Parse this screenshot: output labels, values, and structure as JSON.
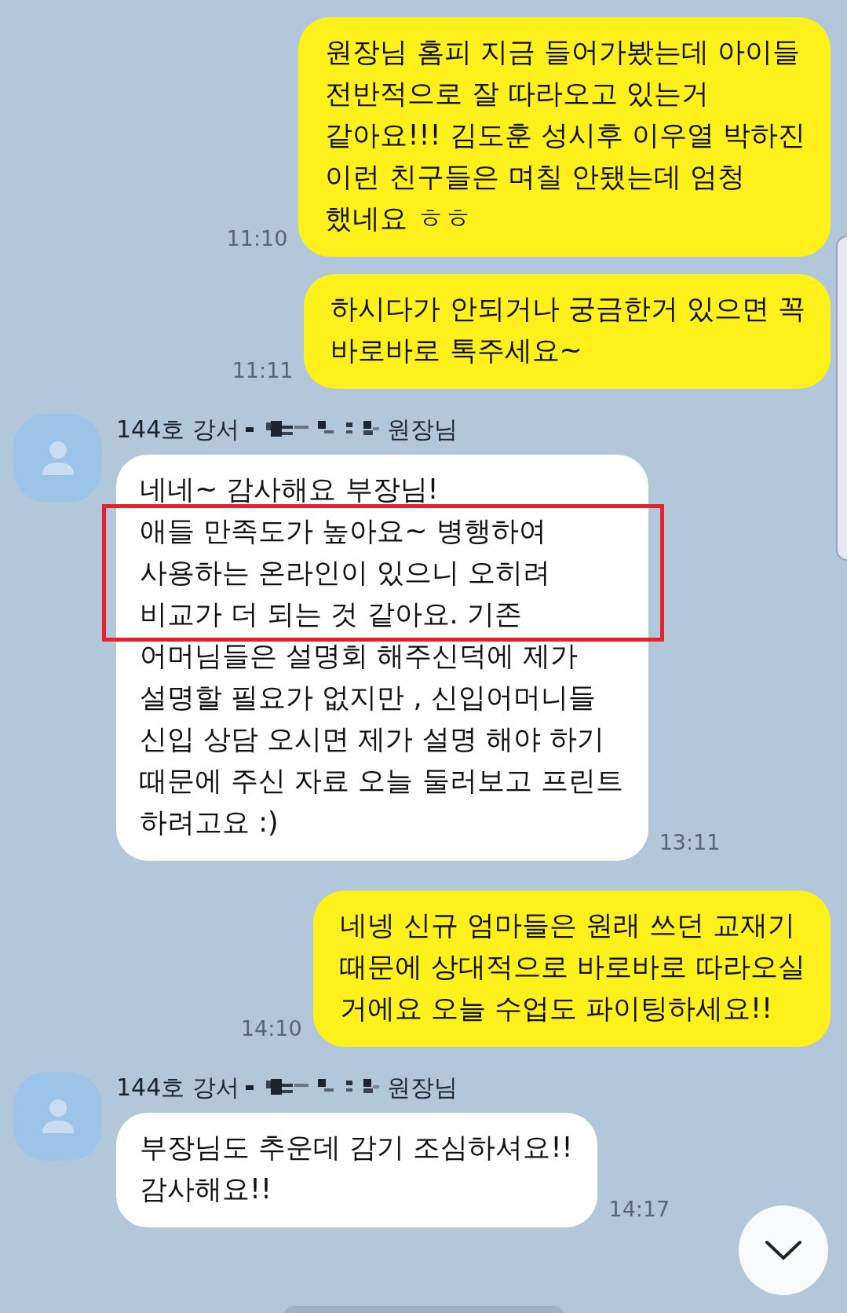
{
  "messages": [
    {
      "kind": "sent",
      "time": "11:10",
      "lines": [
        {
          "text": "원장님 홈피 지금 들어가봤는데 아이들",
          "highlighted": false
        },
        {
          "text": "전반적으로 잘 따라오고 있는거",
          "highlighted": false
        },
        {
          "text": "같아요!!! 김도훈 성시후 이우열 박하진",
          "highlighted": false
        },
        {
          "text": "이런 친구들은 며칠 안됐는데 엄청",
          "highlighted": false
        },
        {
          "text": "했네요 ㅎㅎ",
          "highlighted": false
        }
      ]
    },
    {
      "kind": "sent",
      "time": "11:11",
      "lines": [
        {
          "text": "하시다가 안되거나 궁금한거 있으면 꼭",
          "highlighted": false
        },
        {
          "text": "바로바로 톡주세요~",
          "highlighted": false
        }
      ]
    },
    {
      "kind": "received",
      "sender": {
        "prefix": "144호 강서",
        "suffix": "원장님"
      },
      "time": "13:11",
      "lines": [
        {
          "text": "네네~ 감사해요 부장님!",
          "highlighted": false
        },
        {
          "text": "애들 만족도가 높아요~ 병행하여",
          "highlighted": true
        },
        {
          "text": "사용하는 온라인이 있으니 오히려",
          "highlighted": true
        },
        {
          "text": "비교가 더 되는 것 같아요. 기존",
          "highlighted": true
        },
        {
          "text": "어머님들은 설명회 해주신덕에 제가",
          "highlighted": false
        },
        {
          "text": "설명할 필요가 없지만 , 신입어머니들",
          "highlighted": false
        },
        {
          "text": "신입 상담 오시면 제가 설명 해야 하기",
          "highlighted": false
        },
        {
          "text": "때문에 주신 자료 오늘 둘러보고 프린트",
          "highlighted": false
        },
        {
          "text": "하려고요 :)",
          "highlighted": false
        }
      ]
    },
    {
      "kind": "sent",
      "time": "14:10",
      "lines": [
        {
          "text": "네넹 신규 엄마들은 원래 쓰던 교재기",
          "highlighted": false
        },
        {
          "text": "때문에 상대적으로 바로바로 따라오실",
          "highlighted": false
        },
        {
          "text": "거에요 오늘 수업도 파이팅하세요!!",
          "highlighted": false
        }
      ]
    },
    {
      "kind": "received",
      "sender": {
        "prefix": "144호 강서",
        "suffix": "원장님"
      },
      "time": "14:17",
      "lines": [
        {
          "text": "부장님도 추운데 감기 조심하셔요!!",
          "highlighted": false
        },
        {
          "text": "감사해요!!",
          "highlighted": false
        }
      ]
    }
  ]
}
